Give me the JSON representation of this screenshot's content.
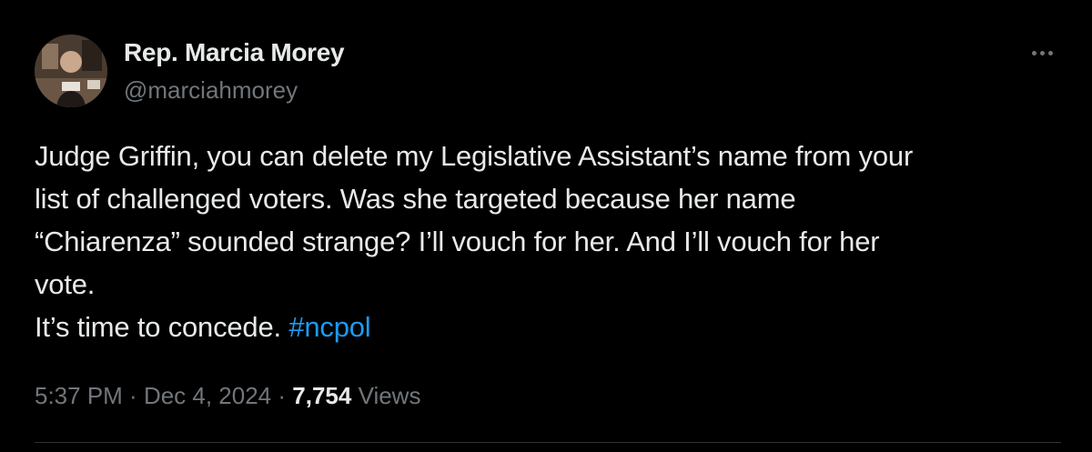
{
  "author": {
    "display_name": "Rep. Marcia Morey",
    "handle": "@marciahmorey"
  },
  "tweet": {
    "lines": [
      "Judge Griffin, you can delete my Legislative Assistant’s name from your",
      "list of challenged voters.  Was she targeted because her name",
      "“Chiarenza” sounded strange? I’ll vouch for her. And I’ll vouch for her",
      "vote."
    ],
    "last_line_text": "It’s time to concede. ",
    "hashtag": "#ncpol"
  },
  "meta": {
    "time": "5:37 PM",
    "separator": " · ",
    "date": "Dec 4, 2024",
    "views_count": "7,754",
    "views_label": "Views"
  },
  "icons": {
    "more": "more-horizontal-icon"
  },
  "colors": {
    "background": "#000000",
    "text": "#e7e9ea",
    "secondary_text": "#71767b",
    "link": "#1d9bf0",
    "divider": "#2f3336"
  }
}
